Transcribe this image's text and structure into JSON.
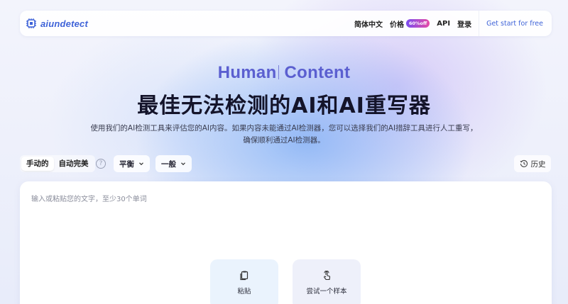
{
  "brand": {
    "name": "aiundetect",
    "accent": "#3f63d8"
  },
  "nav": {
    "lang": "简体中文",
    "price": "价格",
    "price_badge": "60%off",
    "api": "API",
    "login": "登录",
    "cta": "Get start for free"
  },
  "hero": {
    "title_en_left": "Human",
    "title_en_right": "Content",
    "title_zh": "最佳无法检测的AI和AI重写器",
    "description_line1": "使用我们的AI检测工具来评估您的AI内容。如果内容未能通过AI检测器，您可以选择我们的AI措辞工具进行人工重写，",
    "description_line2": "确保顺利通过AI检测器。"
  },
  "controls": {
    "mode_manual": "手动的",
    "mode_auto": "自动完美",
    "help_icon": "question-circle-icon",
    "select_balance": "平衡",
    "select_general": "一般",
    "history": "历史"
  },
  "editor": {
    "placeholder": "输入或粘贴您的文字，至少30个单词",
    "paste_label": "粘贴",
    "sample_label": "尝试一个样本"
  }
}
